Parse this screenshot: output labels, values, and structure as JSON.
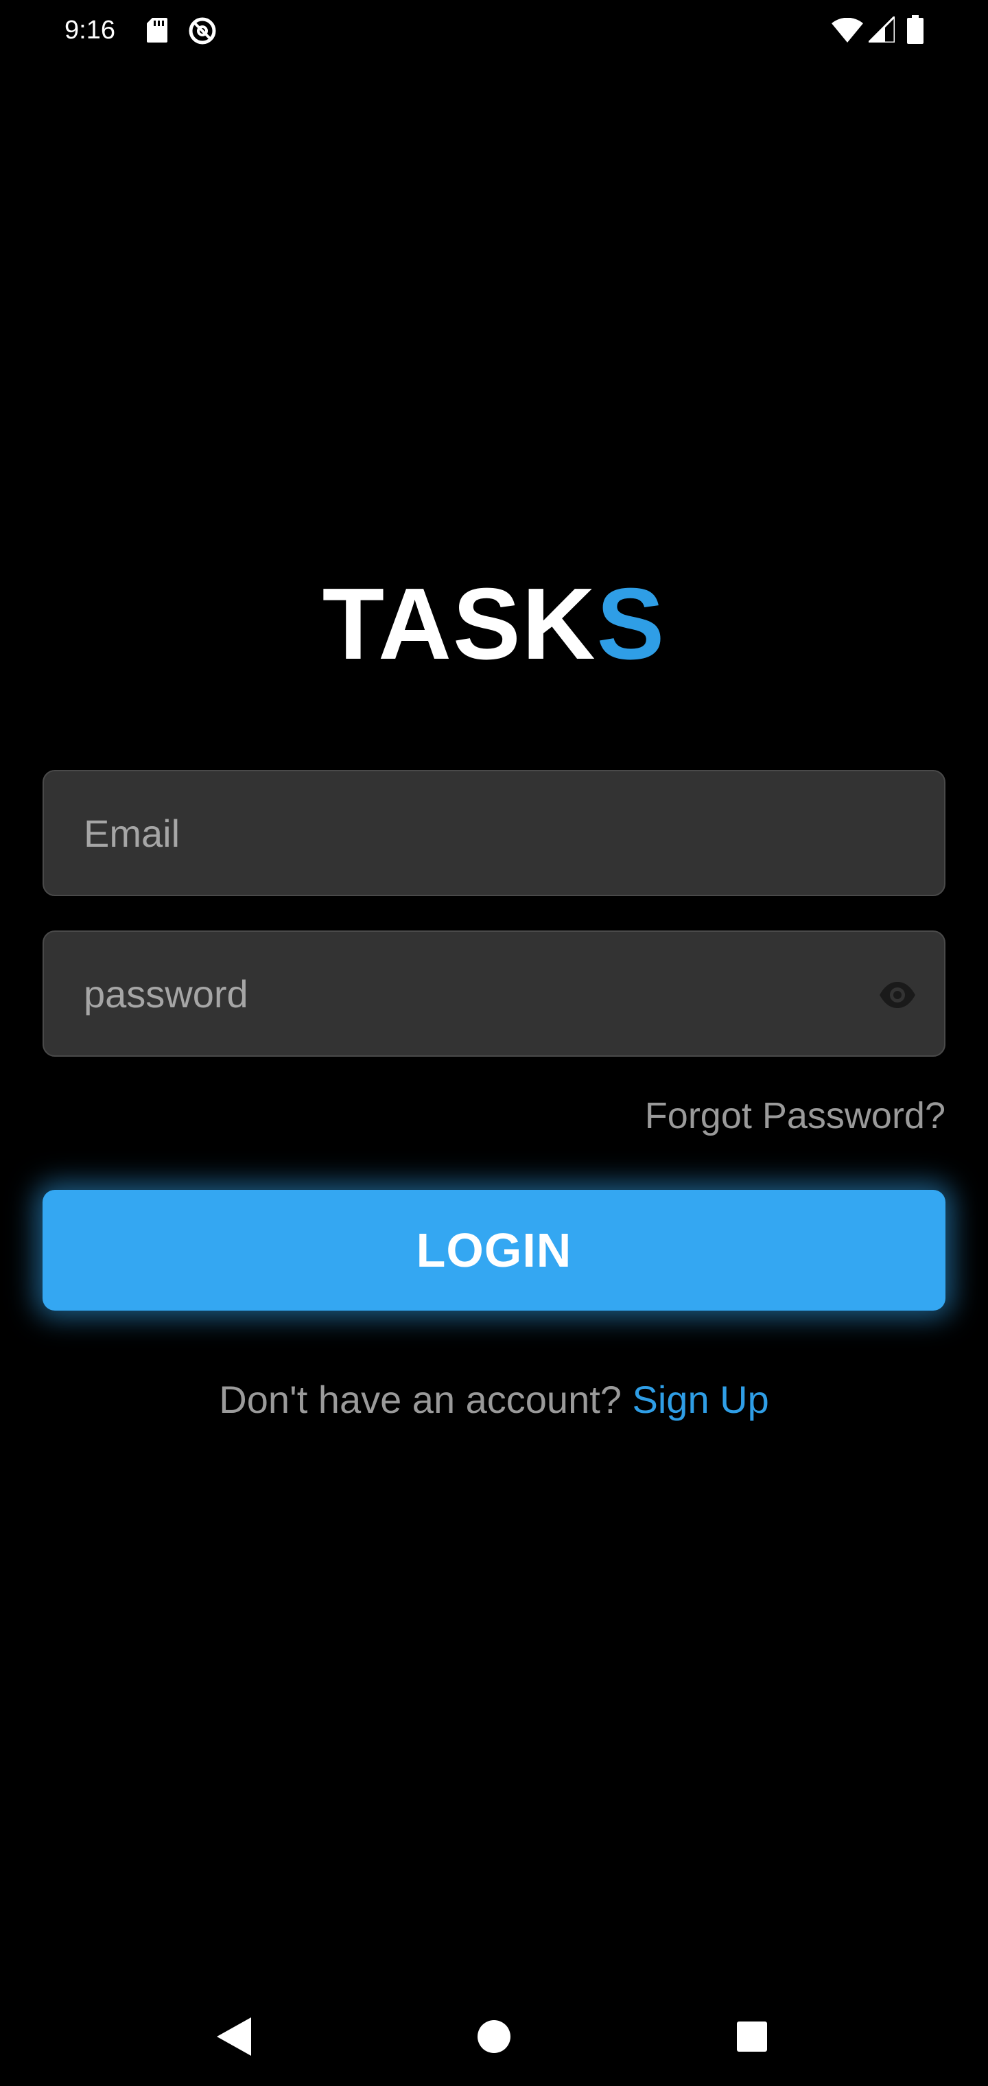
{
  "status_bar": {
    "time": "9:16",
    "icons": [
      "sd-card-icon",
      "do-not-disturb-icon",
      "wifi-icon",
      "cell-signal-icon",
      "battery-icon"
    ]
  },
  "logo": {
    "main": "TASK",
    "accent": "S",
    "accent_color": "#2f9ee6"
  },
  "form": {
    "email": {
      "placeholder": "Email",
      "value": ""
    },
    "password": {
      "placeholder": "password",
      "value": "",
      "toggle_icon": "eye-icon"
    },
    "forgot_label": "Forgot Password?",
    "login_label": "LOGIN",
    "login_color": "#34a7f2"
  },
  "signup": {
    "prompt": "Don't have an account?",
    "link": "Sign Up"
  },
  "nav_bar": {
    "icons": [
      "back-icon",
      "home-icon",
      "recents-icon"
    ]
  }
}
